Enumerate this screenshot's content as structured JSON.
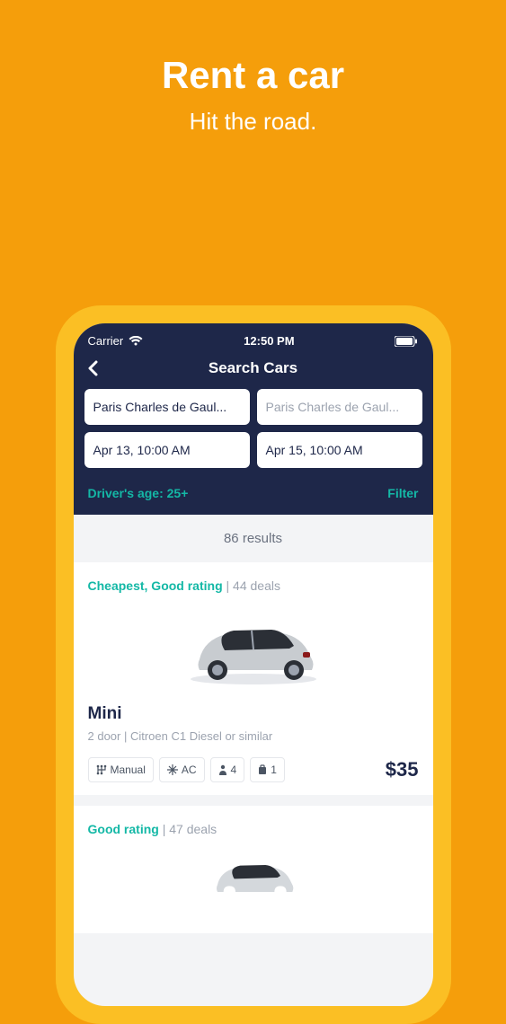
{
  "hero": {
    "title": "Rent a car",
    "subtitle": "Hit the road."
  },
  "statusBar": {
    "carrier": "Carrier",
    "time": "12:50 PM"
  },
  "nav": {
    "title": "Search Cars"
  },
  "search": {
    "pickupLocation": "Paris Charles de Gaul...",
    "dropoffLocation": "Paris Charles de Gaul...",
    "pickupDate": "Apr 13, 10:00 AM",
    "dropoffDate": "Apr 15, 10:00 AM",
    "driverAge": "Driver's age: 25+",
    "filterLabel": "Filter"
  },
  "results": {
    "count": "86 results"
  },
  "cards": [
    {
      "highlight": "Cheapest, Good rating",
      "deals": " | 44 deals",
      "name": "Mini",
      "desc": "2 door | Citroen C1 Diesel or similar",
      "transmission": "Manual",
      "ac": "AC",
      "passengers": "4",
      "bags": "1",
      "price": "$35"
    },
    {
      "highlight": "Good rating",
      "deals": " | 47 deals"
    }
  ]
}
